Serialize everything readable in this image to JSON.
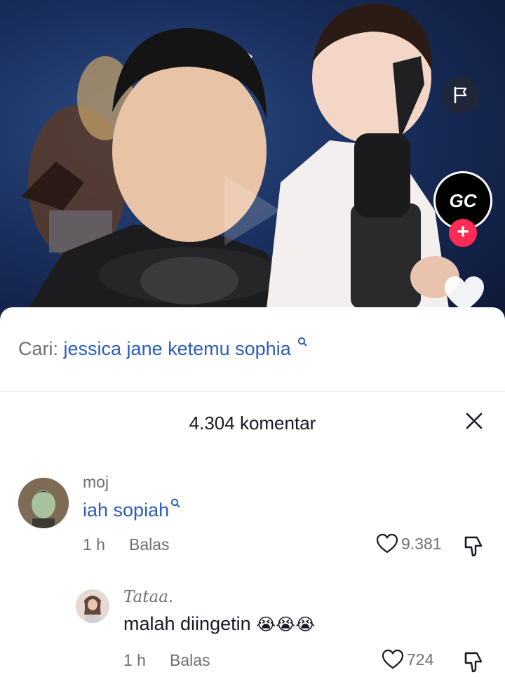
{
  "video": {
    "creator_badge": "GC",
    "icons": {
      "report": "flag-icon",
      "follow": "plus-icon",
      "like": "heart-icon"
    }
  },
  "search": {
    "prefix": "Cari:",
    "query": "jessica jane ketemu sophia",
    "icon": "search-icon"
  },
  "comments_header": {
    "count_label": "4.304 komentar",
    "close_icon": "close-icon"
  },
  "comments": [
    {
      "username": "moj",
      "text": "iah sopiah",
      "time": "1 h",
      "reply_label": "Balas",
      "likes": "9.381"
    }
  ],
  "replies": [
    {
      "username": "Tataa.",
      "text": "malah diingetin",
      "emoji": "😭😭😭",
      "time": "1 h",
      "reply_label": "Balas",
      "likes": "724"
    }
  ],
  "colors": {
    "link": "#2b5db9",
    "muted": "#6f7077",
    "accent": "#fe2c55"
  }
}
